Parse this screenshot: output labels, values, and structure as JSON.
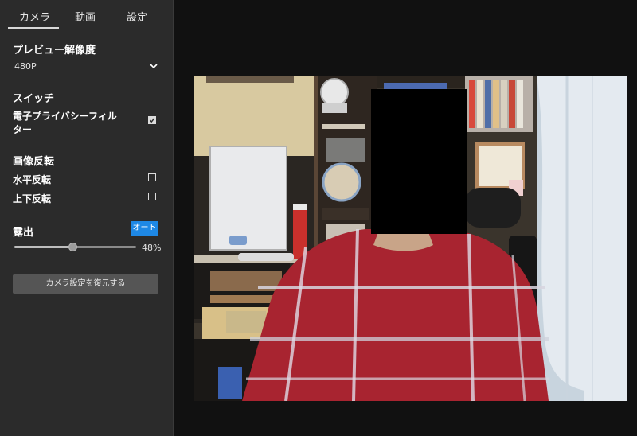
{
  "tabs": [
    {
      "label": "カメラ",
      "active": true
    },
    {
      "label": "動画",
      "active": false
    },
    {
      "label": "設定",
      "active": false
    }
  ],
  "resolution": {
    "heading": "プレビュー解像度",
    "selected": "480P",
    "icon": "chevron-down-icon"
  },
  "switch": {
    "heading": "スイッチ",
    "privacy_filter_line1": "電子プライバシーフィル",
    "privacy_filter_line2": "ター",
    "privacy_filter_checked": true
  },
  "flip": {
    "heading": "画像反転",
    "horizontal_label": "水平反転",
    "horizontal_checked": false,
    "vertical_label": "上下反転",
    "vertical_checked": false
  },
  "exposure": {
    "heading": "露出",
    "auto_label": "オート",
    "value_text": "48%",
    "value": 0.48
  },
  "restore_button": "カメラ設定を復元する",
  "colors": {
    "sidebar_bg": "#2b2b2b",
    "page_bg": "#111111",
    "accent": "#1e88e5",
    "button_bg": "#555555"
  }
}
